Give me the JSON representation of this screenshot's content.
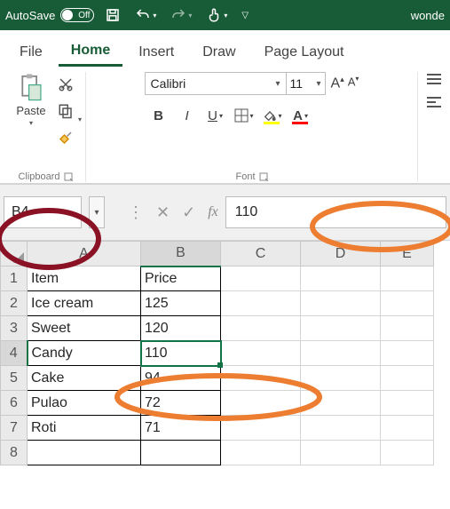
{
  "titlebar": {
    "autosave_label": "AutoSave",
    "autosave_state": "Off",
    "filename_partial": "wonde"
  },
  "tabs": {
    "file": "File",
    "home": "Home",
    "insert": "Insert",
    "draw": "Draw",
    "page_layout": "Page Layout"
  },
  "ribbon": {
    "clipboard": {
      "paste": "Paste",
      "label": "Clipboard"
    },
    "font": {
      "name": "Calibri",
      "size": "11",
      "label": "Font"
    }
  },
  "name_box": "B4",
  "formula_bar_value": "110",
  "columns": [
    "A",
    "B",
    "C",
    "D",
    "E"
  ],
  "rows": [
    {
      "n": "1",
      "a": "Item",
      "b": "Price"
    },
    {
      "n": "2",
      "a": "Ice cream",
      "b": "125"
    },
    {
      "n": "3",
      "a": "Sweet",
      "b": "120"
    },
    {
      "n": "4",
      "a": "Candy",
      "b": "110"
    },
    {
      "n": "5",
      "a": "Cake",
      "b": "94"
    },
    {
      "n": "6",
      "a": "Pulao",
      "b": "72"
    },
    {
      "n": "7",
      "a": "Roti",
      "b": "71"
    }
  ],
  "styles": {
    "fill_color": "#ffff00",
    "font_color": "#ff0000",
    "annotation_orange": "#ed7d31",
    "annotation_red": "#8a1224"
  }
}
